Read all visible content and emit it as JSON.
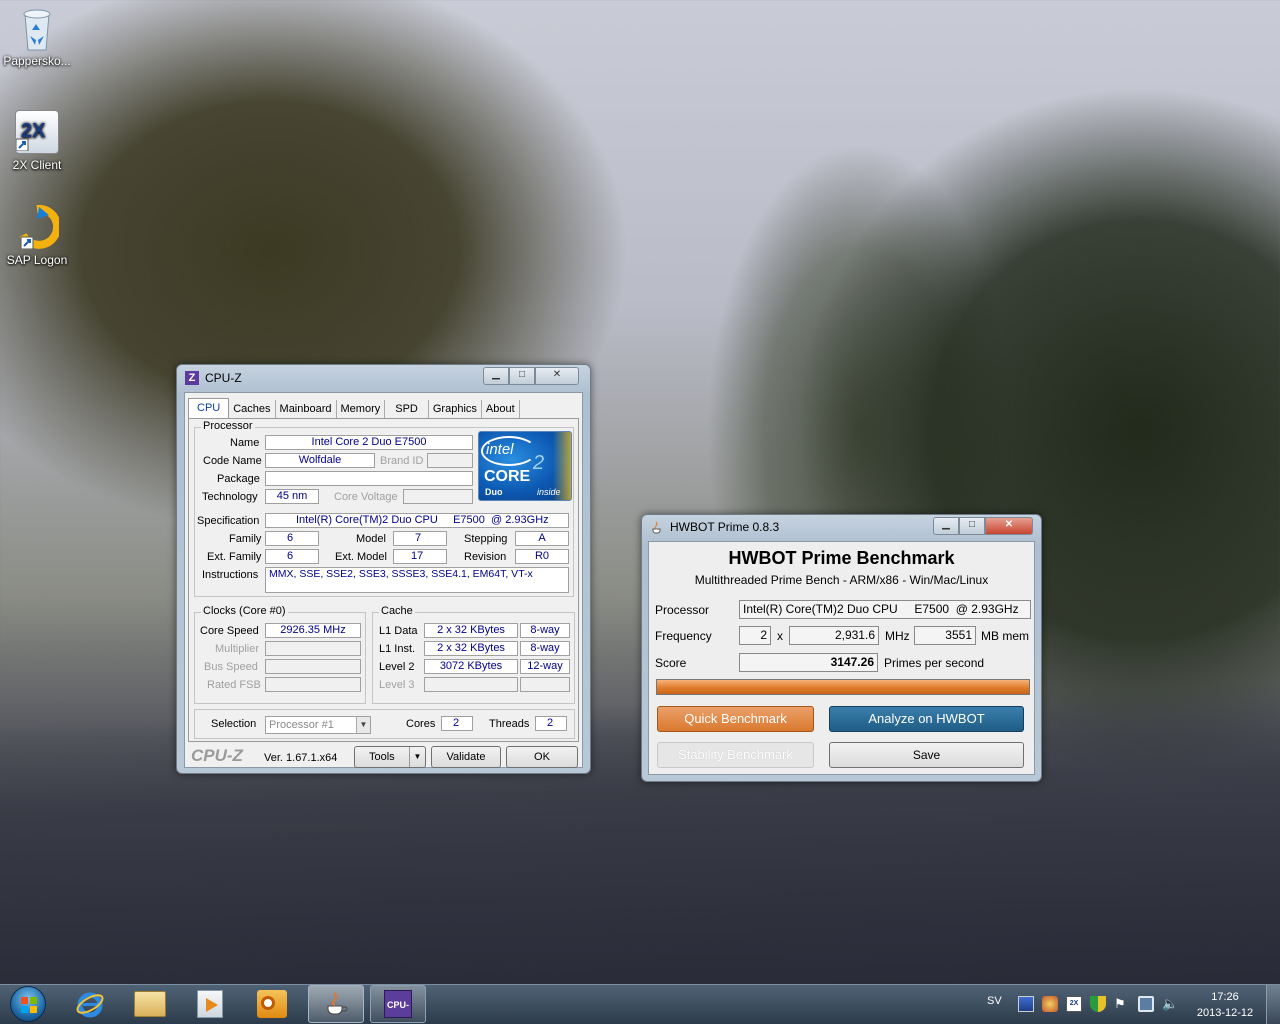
{
  "desktop": {
    "icons": [
      {
        "label": "Pappersko..."
      },
      {
        "label": "2X Client"
      },
      {
        "label": "SAP Logon"
      }
    ]
  },
  "cpuz": {
    "title": "CPU-Z",
    "tabs": [
      "CPU",
      "Caches",
      "Mainboard",
      "Memory",
      "SPD",
      "Graphics",
      "About"
    ],
    "processor": {
      "group": "Processor",
      "name_label": "Name",
      "name": "Intel Core 2 Duo E7500",
      "codename_label": "Code Name",
      "codename": "Wolfdale",
      "brandid_label": "Brand ID",
      "package_label": "Package",
      "technology_label": "Technology",
      "technology": "45 nm",
      "corevoltage_label": "Core Voltage",
      "spec_label": "Specification",
      "spec": "Intel(R) Core(TM)2 Duo CPU     E7500  @ 2.93GHz",
      "family_label": "Family",
      "family": "6",
      "model_label": "Model",
      "model": "7",
      "stepping_label": "Stepping",
      "stepping": "A",
      "extfamily_label": "Ext. Family",
      "extfamily": "6",
      "extmodel_label": "Ext. Model",
      "extmodel": "17",
      "revision_label": "Revision",
      "revision": "R0",
      "instructions_label": "Instructions",
      "instructions": "MMX, SSE, SSE2, SSE3, SSSE3, SSE4.1, EM64T, VT-x"
    },
    "logo": {
      "intel": "intel",
      "core": "CORE",
      "duo": "Duo",
      "inside": "inside",
      "two": "2"
    },
    "clocks": {
      "group": "Clocks (Core #0)",
      "corespeed_label": "Core Speed",
      "corespeed": "2926.35 MHz",
      "multiplier_label": "Multiplier",
      "busspeed_label": "Bus Speed",
      "ratedfsb_label": "Rated FSB"
    },
    "cache": {
      "group": "Cache",
      "l1data_label": "L1 Data",
      "l1data": "2 x 32 KBytes",
      "l1data_way": "8-way",
      "l1inst_label": "L1 Inst.",
      "l1inst": "2 x 32 KBytes",
      "l1inst_way": "8-way",
      "level2_label": "Level 2",
      "level2": "3072 KBytes",
      "level2_way": "12-way",
      "level3_label": "Level 3"
    },
    "selection": {
      "label": "Selection",
      "value": "Processor #1",
      "cores_label": "Cores",
      "cores": "2",
      "threads_label": "Threads",
      "threads": "2"
    },
    "footer": {
      "brand": "CPU-Z",
      "version": "Ver. 1.67.1.x64",
      "tools": "Tools",
      "validate": "Validate",
      "ok": "OK"
    }
  },
  "hwbot": {
    "title": "HWBOT Prime 0.8.3",
    "heading": "HWBOT Prime Benchmark",
    "subheading": "Multithreaded Prime Bench - ARM/x86 - Win/Mac/Linux",
    "processor_label": "Processor",
    "processor": "Intel(R) Core(TM)2 Duo CPU     E7500  @ 2.93GHz",
    "frequency_label": "Frequency",
    "cores": "2",
    "x": "x",
    "frequency": "2,931.6",
    "mhz": "MHz",
    "mem": "3551",
    "mem_label": "MB mem",
    "score_label": "Score",
    "score": "3147.26",
    "score_unit": "Primes per second",
    "progress": 1.0,
    "quick": "Quick Benchmark",
    "analyze": "Analyze on HWBOT",
    "stability": "Stability Benchmark",
    "save": "Save",
    "colors": {
      "orange": "#e07c2c",
      "blue": "#1f5d86"
    }
  },
  "taskbar": {
    "lang": "SV",
    "time": "17:26",
    "date": "2013-12-12",
    "pinned": [
      "start-orb",
      "internet-explorer",
      "windows-explorer",
      "media-player",
      "outlook",
      "java",
      "cpu-z"
    ],
    "cpuz_label": "CPU-Z"
  }
}
